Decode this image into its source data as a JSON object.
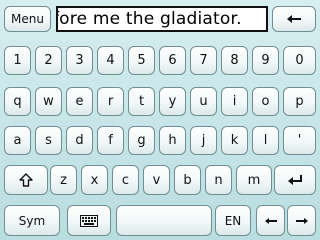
{
  "top_bar": {
    "menu_label": "Menu",
    "input_value": "fore me the gladiator.",
    "backspace_icon": "arrow-left-icon"
  },
  "rows": {
    "numbers": [
      "1",
      "2",
      "3",
      "4",
      "5",
      "6",
      "7",
      "8",
      "9",
      "0"
    ],
    "top": [
      "q",
      "w",
      "e",
      "r",
      "t",
      "y",
      "u",
      "i",
      "o",
      "p"
    ],
    "middle": [
      "a",
      "s",
      "d",
      "f",
      "g",
      "h",
      "j",
      "k",
      "l",
      "'"
    ],
    "bottom": [
      "z",
      "x",
      "c",
      "v",
      "b",
      "n",
      "m"
    ]
  },
  "bottom_bar": {
    "sym_label": "Sym",
    "language_label": "EN",
    "keyboard_icon": "keyboard-icon",
    "left_arrow_icon": "arrow-left-icon",
    "right_arrow_icon": "arrow-right-icon"
  },
  "icons": {
    "shift": "shift-icon",
    "enter": "enter-icon"
  }
}
